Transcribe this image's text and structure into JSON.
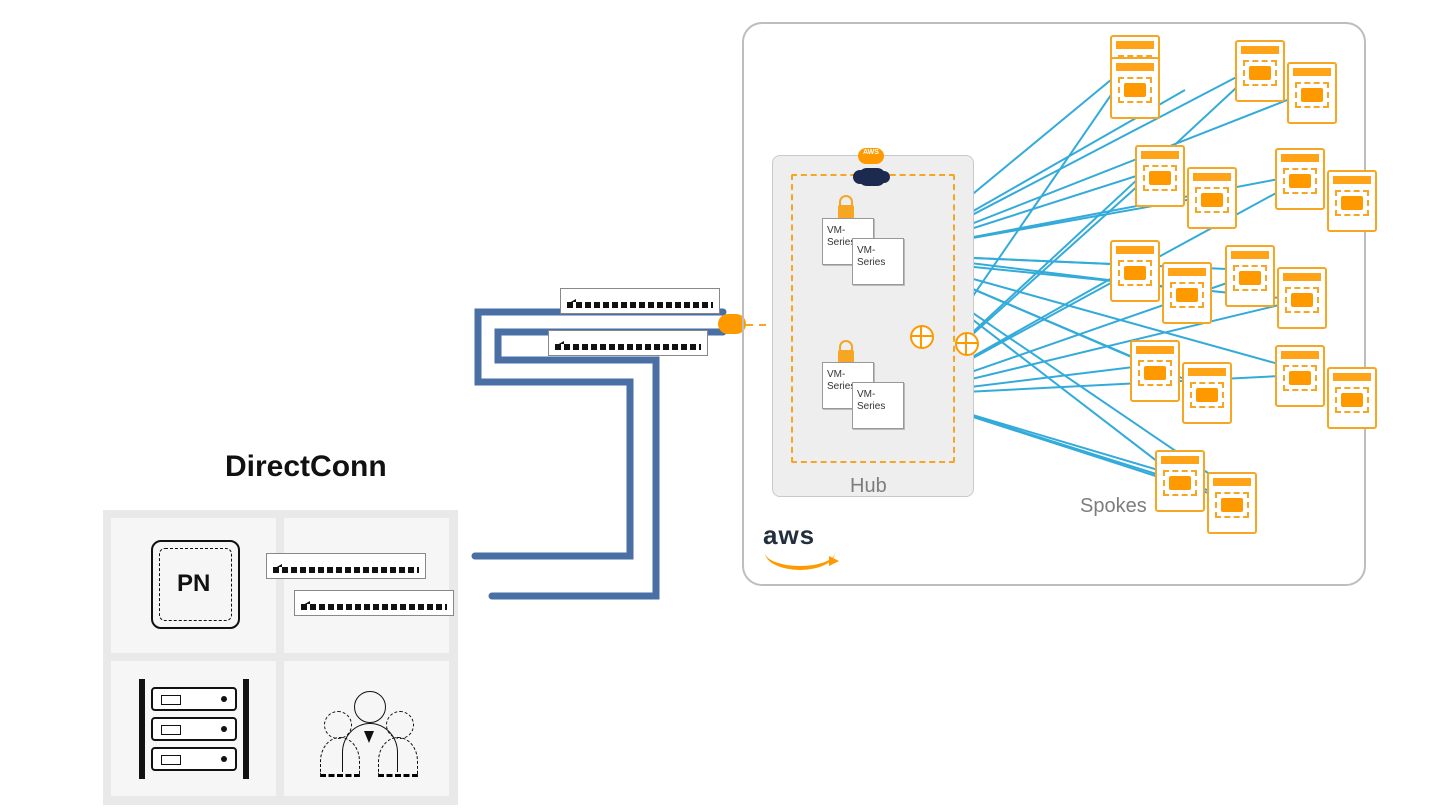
{
  "title": "DirectConn",
  "onprem": {
    "pn_label": "PN"
  },
  "aws": {
    "logo_text": "aws",
    "hub_label": "Hub",
    "spokes_label": "Spokes",
    "aws_badge": "AWS",
    "vm_label_1": "VM-",
    "vm_label_2": "Series",
    "vm_label_3": "VM-",
    "vm_label_4": "Series",
    "vm_label_5": "VM-",
    "vm_label_6": "Series",
    "vm_label_7": "VM-",
    "vm_label_8": "Series"
  }
}
